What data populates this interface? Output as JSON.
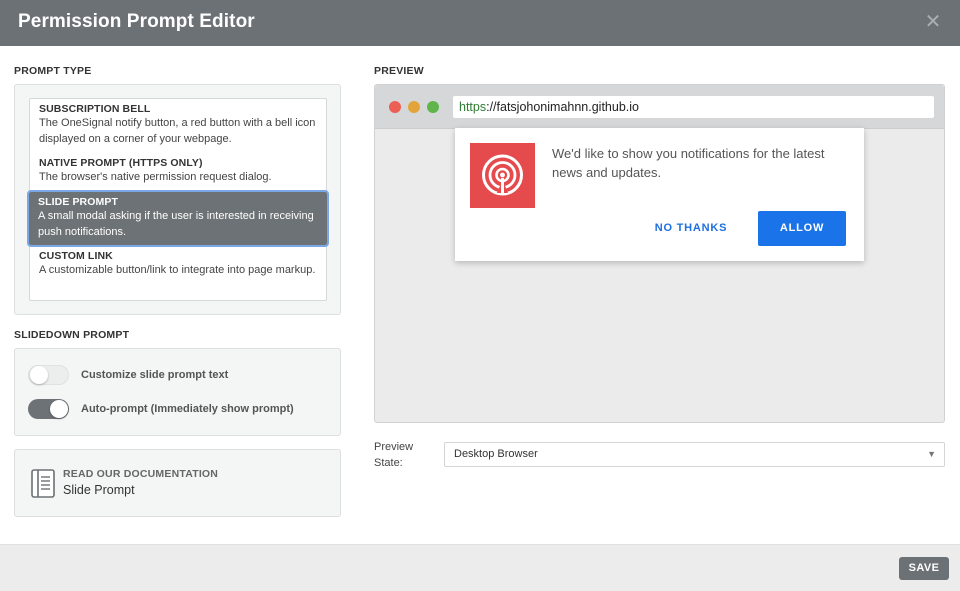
{
  "header": {
    "title": "Permission Prompt Editor",
    "close_icon": "close-icon",
    "close_glyph": "✕"
  },
  "prompt_type": {
    "label": "PROMPT TYPE",
    "items": [
      {
        "name": "SUBSCRIPTION BELL",
        "desc": "The OneSignal notify button, a red button with a bell icon displayed on a corner of your webpage.",
        "selected": false
      },
      {
        "name": "NATIVE PROMPT (HTTPS ONLY)",
        "desc": "The browser's native permission request dialog.",
        "selected": false
      },
      {
        "name": "SLIDE PROMPT",
        "desc": "A small modal asking if the user is interested in receiving push notifications.",
        "selected": true
      },
      {
        "name": "CUSTOM LINK",
        "desc": "A customizable button/link to integrate into page markup.",
        "selected": false
      }
    ]
  },
  "slidedown": {
    "label": "SLIDEDOWN PROMPT",
    "options": [
      {
        "label": "Customize slide prompt text",
        "on": false
      },
      {
        "label": "Auto-prompt (Immediately show prompt)",
        "on": true
      }
    ]
  },
  "docs": {
    "icon": "document-icon",
    "heading": "READ OUR DOCUMENTATION",
    "link": "Slide Prompt"
  },
  "preview": {
    "label": "PREVIEW",
    "url_scheme": "https",
    "url_rest": "://fatsjohonimahnn.github.io",
    "window_dots": [
      "#ec5f55",
      "#e3a53a",
      "#5fb549"
    ],
    "slide": {
      "icon": "broadcast-icon",
      "icon_color": "#e54b4d",
      "message": "We'd like to show you notifications for the latest news and updates.",
      "cancel": "NO THANKS",
      "accept": "ALLOW",
      "accent": "#1a73e8"
    },
    "state_label": "Preview State:",
    "state_value": "Desktop Browser"
  },
  "footer": {
    "save": "SAVE"
  }
}
